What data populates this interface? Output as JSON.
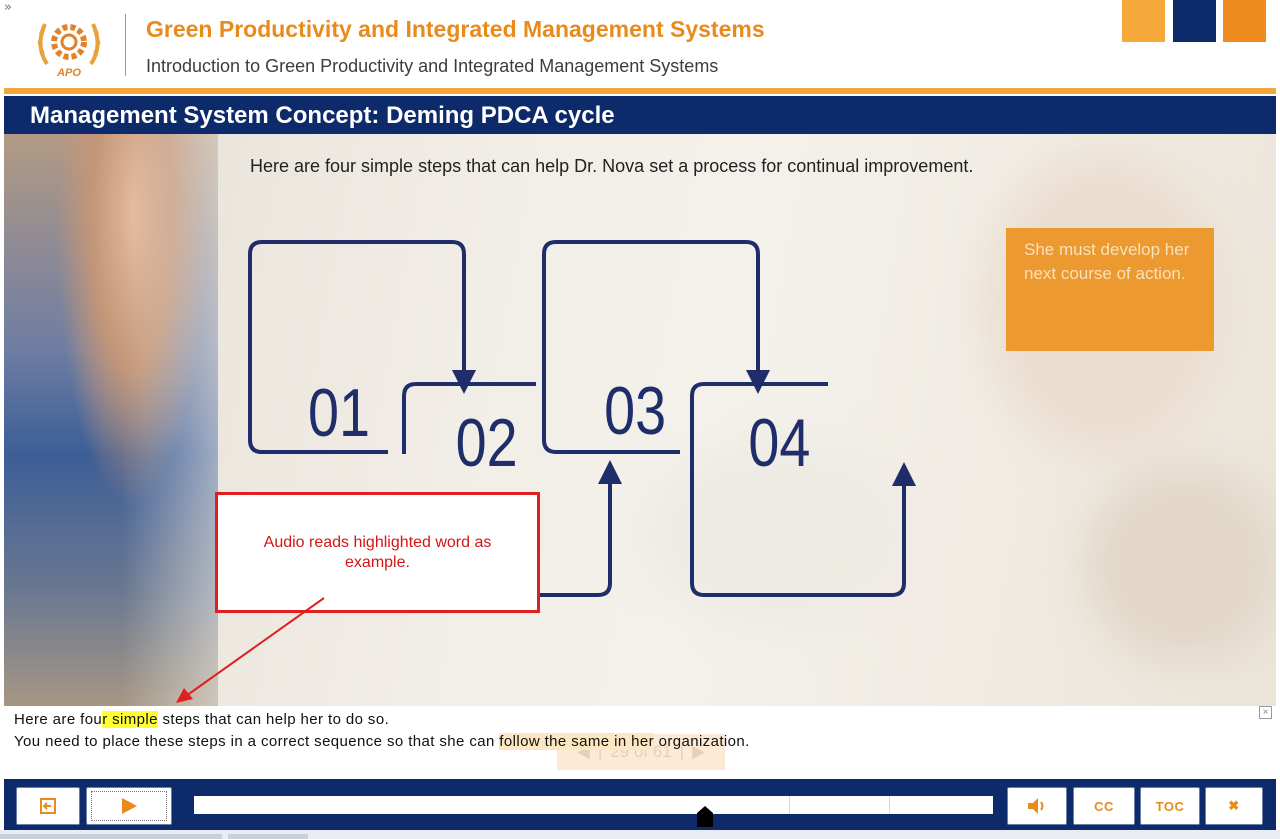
{
  "header": {
    "toggle_icon": "»",
    "logo_text": "APO",
    "course_title": "Green Productivity and Integrated Management Systems",
    "course_subtitle": "Introduction to Green Productivity and Integrated Management Systems",
    "brand_colors": [
      "#f5a93a",
      "#0d2a6b",
      "#ee8a1e"
    ]
  },
  "slide": {
    "title": "Management System Concept: Deming PDCA cycle",
    "intro": "Here are four simple steps that can help Dr. Nova set a process for continual improvement.",
    "steps": [
      "01",
      "02",
      "03",
      "04"
    ],
    "tip": "She must develop her next course of action.",
    "accent_color": "#1f2e6b"
  },
  "annotation": {
    "text": "Audio reads highlighted word as example.",
    "color": "#e02020"
  },
  "caption": {
    "line1_before": "Here are fou",
    "line1_highlight": "r simple",
    "line1_after": " steps that can help her to do so.",
    "line2_before": "You need to place these steps in a correct sequence so that she can ",
    "line2_highlight": "follow the same in her",
    "line2_after": " organization.",
    "close_icon": "×",
    "pager_text": "29 of 61"
  },
  "controls": {
    "cc_label": "CC",
    "toc_label": "TOC",
    "close_label": "✖",
    "progress": 0.64
  }
}
